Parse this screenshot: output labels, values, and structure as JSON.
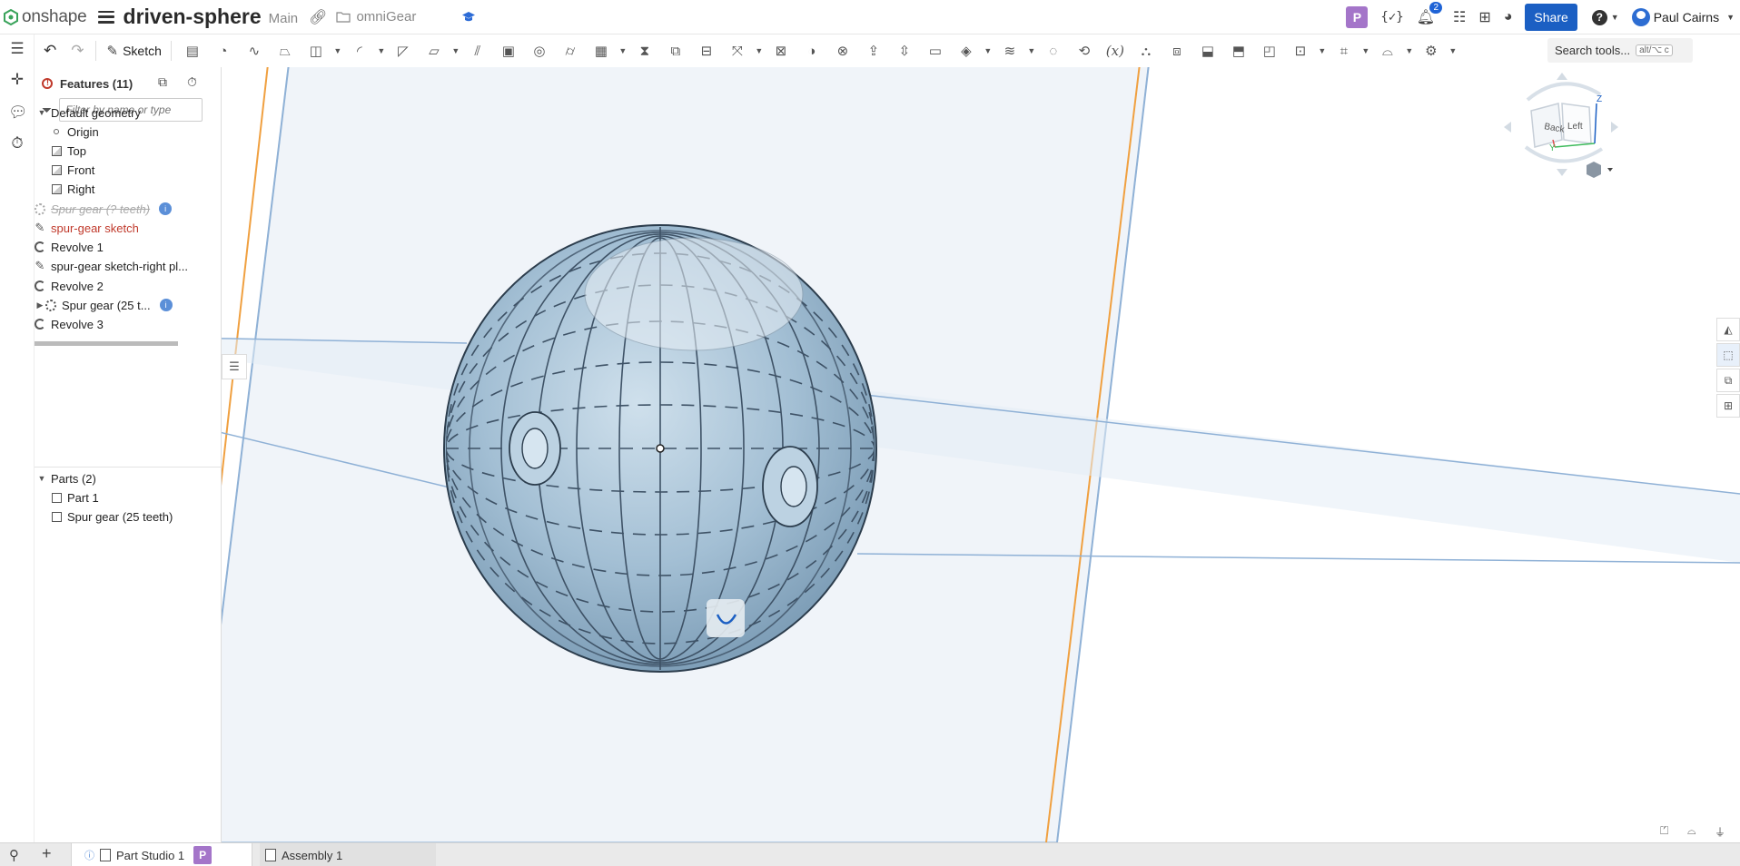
{
  "app": {
    "logo_text": "onshape",
    "document_title": "driven-sphere",
    "workspace": "Main",
    "folder_name": "omniGear"
  },
  "topbar": {
    "workspace_badge": "P",
    "notification_count": "2",
    "share_label": "Share",
    "user_name": "Paul Cairns"
  },
  "toolbar": {
    "sketch_label": "Sketch",
    "search_label": "Search tools...",
    "search_shortcut": "alt/⌥ c"
  },
  "feature_panel": {
    "header": "Features (11)",
    "filter_placeholder": "Filter by name or type",
    "default_geometry_label": "Default geometry",
    "default_geometry_items": [
      "Origin",
      "Top",
      "Front",
      "Right"
    ],
    "features": [
      {
        "label": "Spur gear (? teeth)",
        "state": "suppressed"
      },
      {
        "label": "spur-gear sketch",
        "state": "error"
      },
      {
        "label": "Revolve 1",
        "state": "ok"
      },
      {
        "label": "spur-gear sketch-right pl...",
        "state": "ok"
      },
      {
        "label": "Revolve 2",
        "state": "ok"
      },
      {
        "label": "Spur gear (25 t...",
        "state": "ok"
      },
      {
        "label": "Revolve 3",
        "state": "ok"
      }
    ],
    "parts_label": "Parts (2)",
    "parts": [
      "Part 1",
      "Spur gear (25 teeth)"
    ]
  },
  "view_cube": {
    "faces": [
      "Back",
      "Left"
    ],
    "axes": [
      "Z",
      "Y"
    ]
  },
  "bottom_tabs": [
    {
      "label": "Part Studio 1",
      "badge": "P"
    },
    {
      "label": "Assembly 1"
    }
  ],
  "colors": {
    "brand_blue": "#1b5fc3",
    "badge_purple": "#a475c9",
    "error_red": "#c0392b",
    "part_blue": "#a9c3d6",
    "plane_line": "#8fb1d6",
    "plane_orange": "#f0a040"
  }
}
